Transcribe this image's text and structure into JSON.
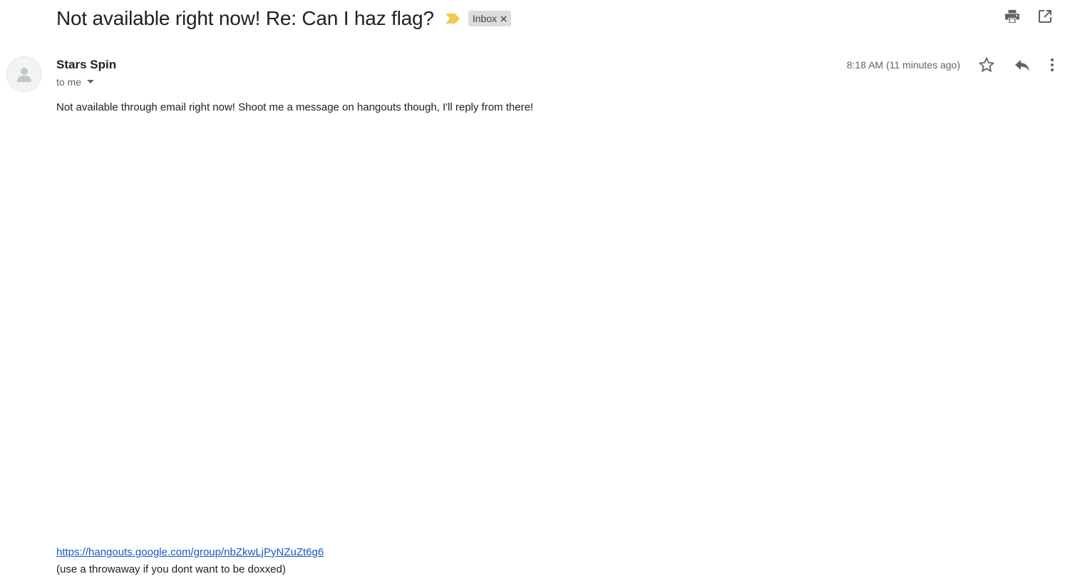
{
  "email": {
    "subject": "Not available right now! Re: Can I haz flag?",
    "label": "Inbox",
    "sender_name": "Stars Spin",
    "recipient": "to me",
    "timestamp": "8:18 AM (11 minutes ago)",
    "body": "Not available through email right now! Shoot me a message on hangouts though, I'll reply from there!",
    "link": "https://hangouts.google.com/group/nbZkwLjPyNZuZt6g6",
    "footer_note": "(use a throwaway if you dont want to be doxxed)"
  },
  "icons": {
    "importance": "importance-marker-icon",
    "label_remove": "close-icon",
    "print": "print-icon",
    "open_new_window": "open-in-new-icon",
    "avatar": "person-icon",
    "caret": "caret-down-icon",
    "star": "star-icon",
    "reply": "reply-icon",
    "more": "more-vert-icon"
  },
  "colors": {
    "importance": "#f2c94c",
    "label_bg": "#dddddd",
    "link": "#1a57c4",
    "icon": "#5f6368"
  }
}
